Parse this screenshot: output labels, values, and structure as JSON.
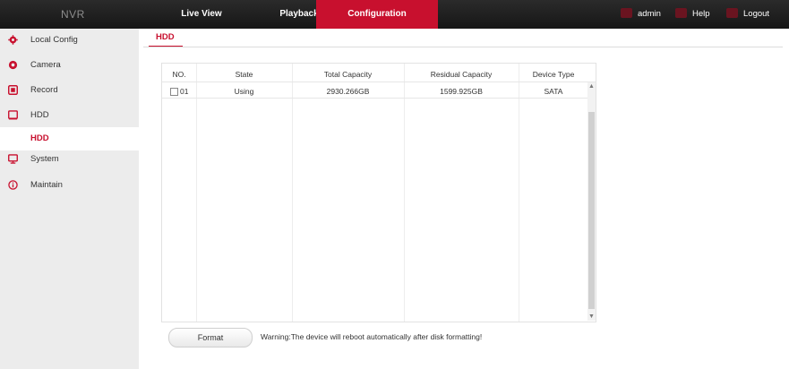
{
  "header": {
    "logo": "NVR",
    "nav": [
      {
        "label": "Live View"
      },
      {
        "label": "Playback"
      },
      {
        "label": "Configuration",
        "active": true
      }
    ],
    "user_label": "admin",
    "help_label": "Help",
    "logout_label": "Logout",
    "accent_color": "#c8102e"
  },
  "sidebar": {
    "items": [
      {
        "label": "Local Config",
        "icon": "gear-icon"
      },
      {
        "label": "Camera",
        "icon": "camera-icon"
      },
      {
        "label": "Record",
        "icon": "record-icon"
      },
      {
        "label": "HDD",
        "icon": "hdd-icon"
      },
      {
        "label": "HDD",
        "sub": true,
        "active": true
      },
      {
        "label": "System",
        "icon": "monitor-icon"
      },
      {
        "label": "Maintain",
        "icon": "info-icon"
      }
    ]
  },
  "main": {
    "tab": "HDD",
    "table": {
      "columns": [
        "NO.",
        "State",
        "Total Capacity",
        "Residual Capacity",
        "Device Type"
      ],
      "rows": [
        {
          "no": "01",
          "state": "Using",
          "total": "2930.266GB",
          "residual": "1599.925GB",
          "type": "SATA"
        }
      ]
    },
    "format_button": "Format",
    "warning": "Warning:The device will reboot automatically after disk formatting!"
  }
}
